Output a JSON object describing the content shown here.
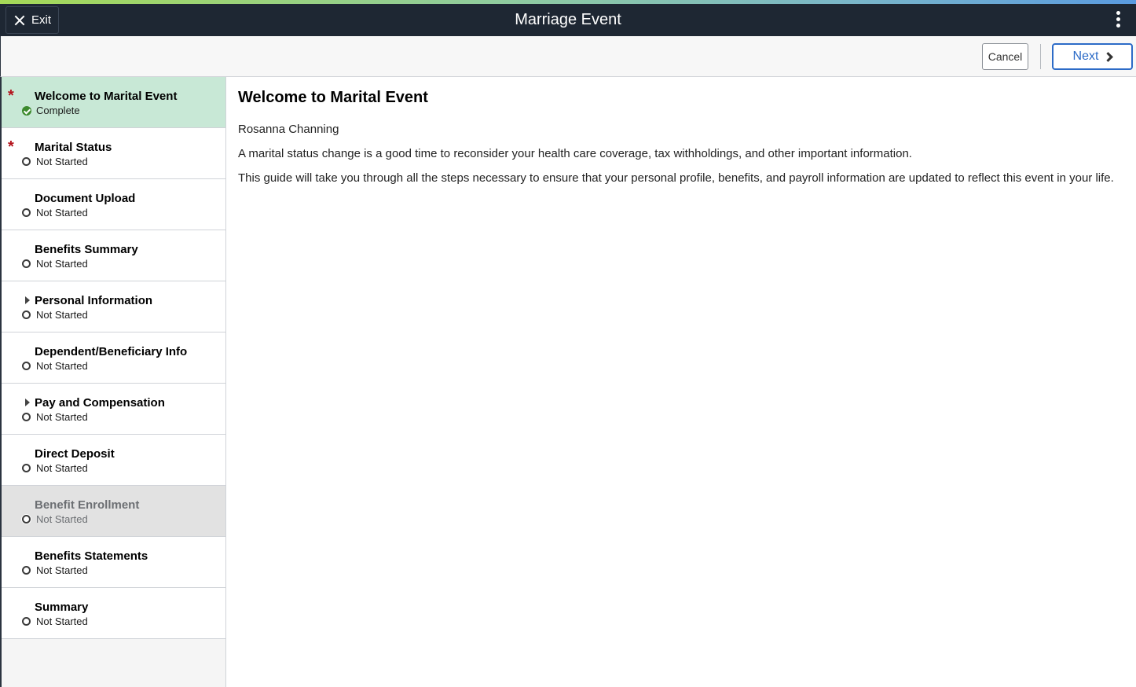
{
  "header": {
    "title": "Marriage Event",
    "exit_label": "Exit",
    "menu_icon": "kebab-menu-icon"
  },
  "toolbar": {
    "cancel_label": "Cancel",
    "next_label": "Next"
  },
  "sidebar": {
    "steps": [
      {
        "label": "Welcome to Marital Event",
        "status": "Complete",
        "required": true,
        "expandable": false,
        "state": "active"
      },
      {
        "label": "Marital Status",
        "status": "Not Started",
        "required": true,
        "expandable": false,
        "state": "normal"
      },
      {
        "label": "Document Upload",
        "status": "Not Started",
        "required": false,
        "expandable": false,
        "state": "normal"
      },
      {
        "label": "Benefits Summary",
        "status": "Not Started",
        "required": false,
        "expandable": false,
        "state": "normal"
      },
      {
        "label": "Personal Information",
        "status": "Not Started",
        "required": false,
        "expandable": true,
        "state": "normal"
      },
      {
        "label": "Dependent/Beneficiary Info",
        "status": "Not Started",
        "required": false,
        "expandable": false,
        "state": "normal"
      },
      {
        "label": "Pay and Compensation",
        "status": "Not Started",
        "required": false,
        "expandable": true,
        "state": "normal"
      },
      {
        "label": "Direct Deposit",
        "status": "Not Started",
        "required": false,
        "expandable": false,
        "state": "normal"
      },
      {
        "label": "Benefit Enrollment",
        "status": "Not Started",
        "required": false,
        "expandable": false,
        "state": "disabled"
      },
      {
        "label": "Benefits Statements",
        "status": "Not Started",
        "required": false,
        "expandable": false,
        "state": "normal"
      },
      {
        "label": "Summary",
        "status": "Not Started",
        "required": false,
        "expandable": false,
        "state": "normal"
      }
    ]
  },
  "main": {
    "heading": "Welcome to Marital Event",
    "employee_name": "Rosanna Channing",
    "paragraph_1": "A marital status change is a good time to reconsider your health care coverage, tax withholdings, and other important information.",
    "paragraph_2": "This guide will take you through all the steps necessary to ensure that your personal profile, benefits, and payroll information are updated to reflect this event in your life."
  },
  "colors": {
    "titlebar_bg": "#1e2733",
    "active_step_bg": "#c8e8d6",
    "required_star": "#b3121b",
    "complete_check": "#3d8a2e",
    "next_button_accent": "#2c6bc7"
  }
}
